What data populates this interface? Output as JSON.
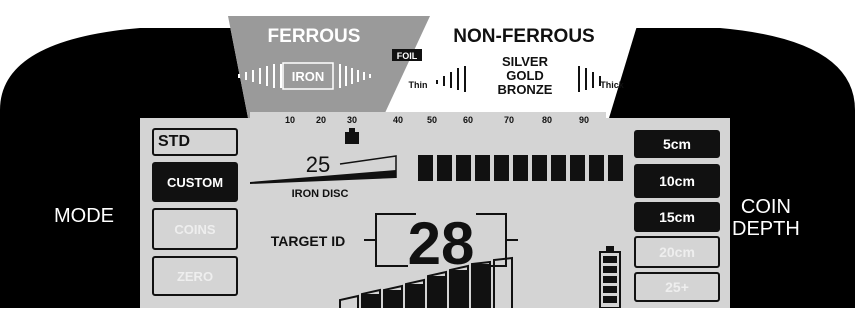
{
  "scale": {
    "ferrous_label": "FERROUS",
    "non_ferrous_label": "NON-FERROUS",
    "iron_label": "IRON",
    "foil_label": "FOIL",
    "thin_label": "Thin",
    "thick_label": "Thick",
    "silver_label": "SILVER",
    "gold_label": "GOLD",
    "bronze_label": "BRONZE",
    "ticks": [
      "10",
      "20",
      "30",
      "40",
      "50",
      "60",
      "70",
      "80",
      "90"
    ]
  },
  "mode": {
    "label": "MODE",
    "std_label": "STD",
    "options": [
      "CUSTOM",
      "COINS",
      "ZERO"
    ],
    "selected": "CUSTOM"
  },
  "iron_disc": {
    "value": "25",
    "label": "IRON DISC"
  },
  "target_id": {
    "label": "TARGET ID",
    "value": "28"
  },
  "coin_depth": {
    "label_line1": "COIN",
    "label_line2": "DEPTH",
    "options": [
      "5cm",
      "10cm",
      "15cm",
      "20cm",
      "25+"
    ],
    "active_count": 3
  },
  "signal_bar": {
    "segments": 11
  },
  "colors": {
    "bezel": "#000000",
    "lcd": "#d4d4d4",
    "lcd_dark": "#111111",
    "ferrous_bg": "#9a9a9a",
    "dim_segment": "#bdbdbd"
  }
}
